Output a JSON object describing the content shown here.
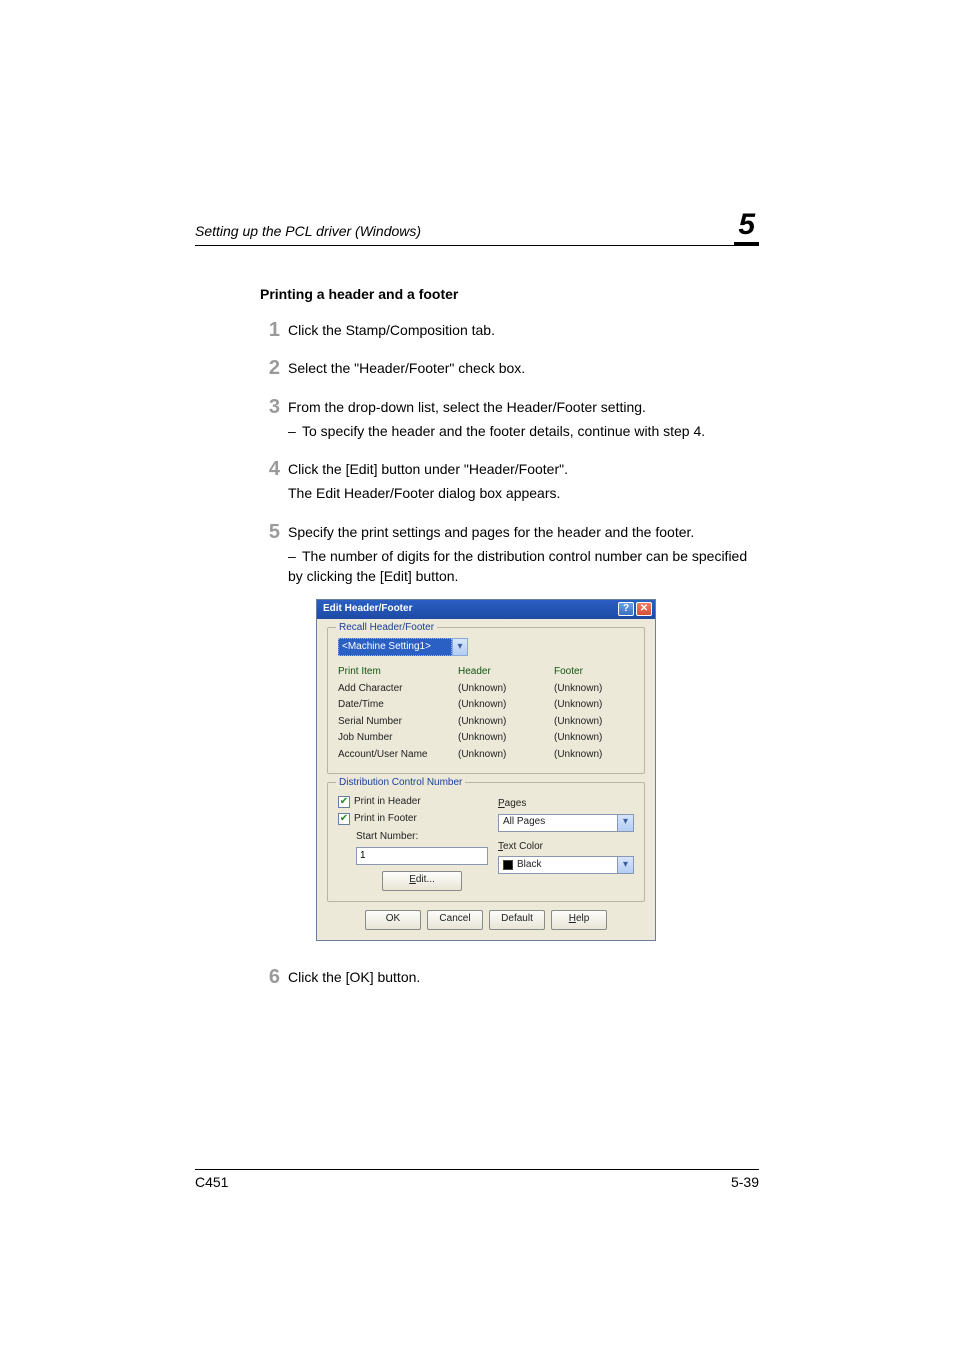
{
  "header": {
    "left": "Setting up the PCL driver (Windows)",
    "chapter": "5"
  },
  "section_title": "Printing a header and a footer",
  "steps": [
    {
      "text": "Click the Stamp/Composition tab."
    },
    {
      "text": "Select the \"Header/Footer\" check box."
    },
    {
      "text": "From the drop-down list, select the Header/Footer setting.",
      "sub": "To specify the header and the footer details, continue with step 4."
    },
    {
      "text": "Click the [Edit] button under \"Header/Footer\".",
      "cont": "The Edit Header/Footer dialog box appears."
    },
    {
      "text": "Specify the print settings and pages for the header and the footer.",
      "sub": "The number of digits for the distribution control number can be specified by clicking the [Edit] button."
    },
    {
      "text": "Click the [OK] button."
    }
  ],
  "dialog": {
    "title": "Edit Header/Footer",
    "recall_legend": "Recall Header/Footer",
    "recall_value": "<Machine Setting1>",
    "columns": {
      "item": "Print Item",
      "header": "Header",
      "footer": "Footer"
    },
    "rows": [
      {
        "item": "Add Character",
        "header": "(Unknown)",
        "footer": "(Unknown)"
      },
      {
        "item": "Date/Time",
        "header": "(Unknown)",
        "footer": "(Unknown)"
      },
      {
        "item": "Serial Number",
        "header": "(Unknown)",
        "footer": "(Unknown)"
      },
      {
        "item": "Job Number",
        "header": "(Unknown)",
        "footer": "(Unknown)"
      },
      {
        "item": "Account/User Name",
        "header": "(Unknown)",
        "footer": "(Unknown)"
      }
    ],
    "dist": {
      "legend": "Distribution Control Number",
      "print_header": "Print in Header",
      "print_footer": "Print in Footer",
      "start_label": "Start Number:",
      "start_value": "1",
      "edit": "Edit...",
      "pages_label": "Pages",
      "pages_value": "All Pages",
      "color_label": "Text Color",
      "color_value": "Black"
    },
    "buttons": {
      "ok": "OK",
      "cancel": "Cancel",
      "default": "Default",
      "help": "Help"
    }
  },
  "footer": {
    "left": "C451",
    "right": "5-39"
  }
}
